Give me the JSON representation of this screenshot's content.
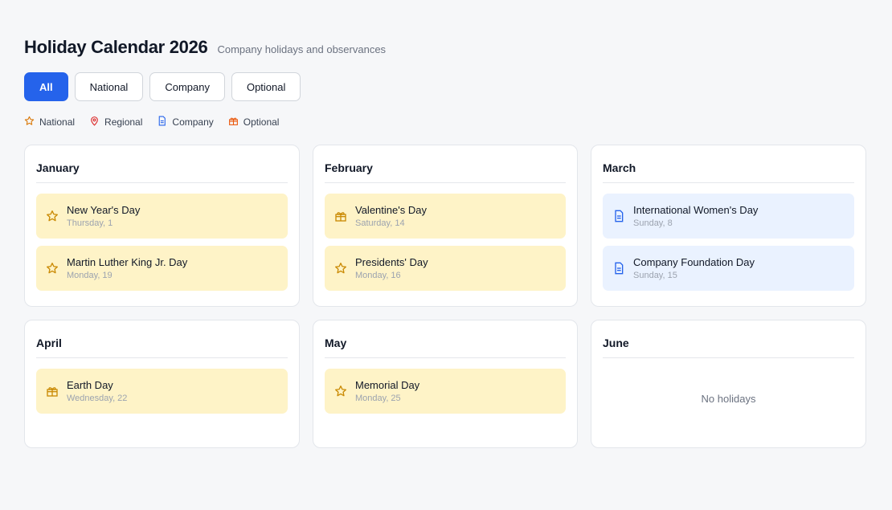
{
  "header": {
    "title": "Holiday Calendar 2026",
    "subtitle": "Company holidays and observances"
  },
  "filters": [
    {
      "label": "All",
      "active": true
    },
    {
      "label": "National",
      "active": false
    },
    {
      "label": "Company",
      "active": false
    },
    {
      "label": "Optional",
      "active": false
    }
  ],
  "legend": [
    {
      "label": "National",
      "icon": "star-icon",
      "color": "#d97706"
    },
    {
      "label": "Regional",
      "icon": "map-pin-icon",
      "color": "#dc2626"
    },
    {
      "label": "Company",
      "icon": "document-icon",
      "color": "#2563eb"
    },
    {
      "label": "Optional",
      "icon": "gift-icon",
      "color": "#ea580c"
    }
  ],
  "months": [
    {
      "name": "January",
      "holidays": [
        {
          "name": "New Year's Day",
          "date": "Thursday, 1",
          "type": "national"
        },
        {
          "name": "Martin Luther King Jr. Day",
          "date": "Monday, 19",
          "type": "national"
        }
      ]
    },
    {
      "name": "February",
      "holidays": [
        {
          "name": "Valentine's Day",
          "date": "Saturday, 14",
          "type": "optional"
        },
        {
          "name": "Presidents' Day",
          "date": "Monday, 16",
          "type": "national"
        }
      ]
    },
    {
      "name": "March",
      "holidays": [
        {
          "name": "International Women's Day",
          "date": "Sunday, 8",
          "type": "company"
        },
        {
          "name": "Company Foundation Day",
          "date": "Sunday, 15",
          "type": "company"
        }
      ]
    },
    {
      "name": "April",
      "holidays": [
        {
          "name": "Earth Day",
          "date": "Wednesday, 22",
          "type": "optional"
        }
      ]
    },
    {
      "name": "May",
      "holidays": [
        {
          "name": "Memorial Day",
          "date": "Monday, 25",
          "type": "national"
        }
      ]
    },
    {
      "name": "June",
      "holidays": [],
      "empty_text": "No holidays"
    }
  ]
}
